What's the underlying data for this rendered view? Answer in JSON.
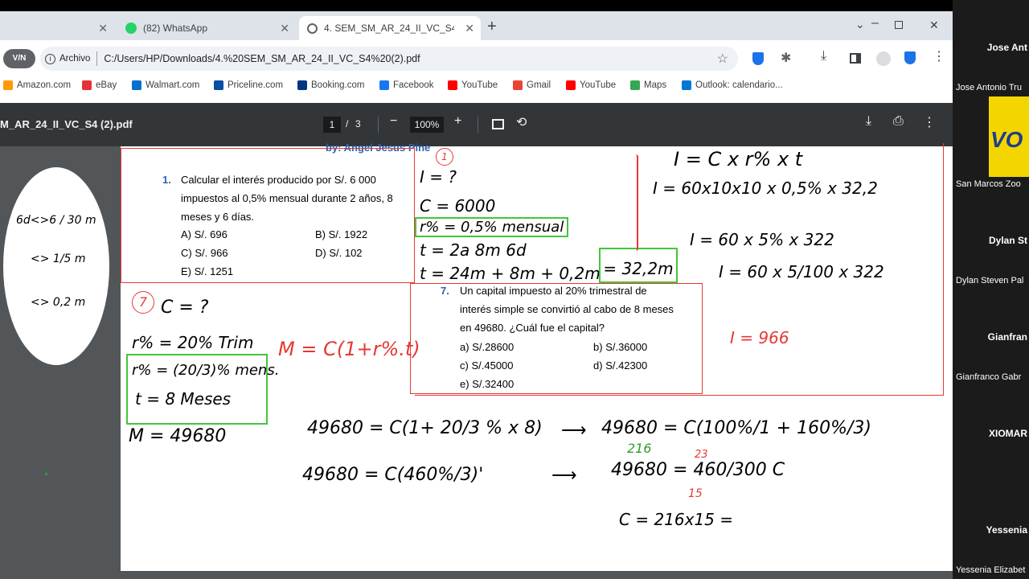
{
  "tabs": [
    {
      "label": ""
    },
    {
      "label": "(82) WhatsApp"
    },
    {
      "label": "4. SEM_SM_AR_24_II_VC_S4 (2).p"
    }
  ],
  "omnibox": {
    "chip": "Archivo",
    "url": "C:/Users/HP/Downloads/4.%20SEM_SM_AR_24_II_VC_S4%20(2).pdf"
  },
  "bookmarks": [
    {
      "label": "Amazon.com",
      "color": "#ff9900"
    },
    {
      "label": "eBay",
      "color": "#e53238"
    },
    {
      "label": "Walmart.com",
      "color": "#0071ce"
    },
    {
      "label": "Priceline.com",
      "color": "#0a4ea2"
    },
    {
      "label": "Booking.com",
      "color": "#003580"
    },
    {
      "label": "Facebook",
      "color": "#1877f2"
    },
    {
      "label": "YouTube",
      "color": "#ff0000"
    },
    {
      "label": "Gmail",
      "color": "#ea4335"
    },
    {
      "label": "YouTube",
      "color": "#ff0000"
    },
    {
      "label": "Maps",
      "color": "#34a853"
    },
    {
      "label": "Outlook: calendario...",
      "color": "#0078d4"
    }
  ],
  "pdf": {
    "title": "M_AR_24_II_VC_S4 (2).pdf",
    "page_current": "1",
    "page_sep": "/",
    "page_total": "3",
    "zoom": "100%"
  },
  "doc": {
    "header": "by: Angel Jesus Pine",
    "p1": {
      "num": "1.",
      "text": [
        "Calcular el interés producido por S/. 6 000",
        "impuestos al 0,5% mensual durante 2 años, 8",
        "meses y 6 días."
      ],
      "options": [
        [
          "A)",
          "S/. 696"
        ],
        [
          "B)",
          "S/. 1922"
        ],
        [
          "C)",
          "S/. 966"
        ],
        [
          "D)",
          "S/. 102"
        ],
        [
          "E)",
          "S/. 1251"
        ]
      ]
    },
    "p7": {
      "num": "7.",
      "text": [
        "Un capital impuesto al 20% trimestral de",
        "interés simple se convirtió al cabo de 8 meses",
        "en 49680. ¿Cuál fue el capital?"
      ],
      "options": [
        [
          "a)",
          "S/.28600"
        ],
        [
          "b)",
          "S/.36000"
        ],
        [
          "c)",
          "S/.45000"
        ],
        [
          "d)",
          "S/.42300"
        ],
        [
          "e)",
          "S/.32400"
        ]
      ]
    }
  },
  "notes": {
    "left": [
      "6d<>6 / 30 m",
      "<> 1/5 m",
      "<> 0,2 m"
    ],
    "sol1": [
      "I = ?",
      "C = 6000",
      "r% = 0,5% mensual",
      "t = 2a 8m 6d",
      "t = 24m + 8m + 0,2m",
      "= 32,2m"
    ],
    "right1": [
      "I = C x r% x t",
      "I = 60x10x10 x 0,5% x 32,2",
      "I = 60 x 5% x 322",
      "I = 60 x 5/100 x 322",
      "I = 966"
    ],
    "sol7": [
      "C = ?",
      "r% = 20% Trim",
      "r% = (20/3)% mens.",
      "t = 8 Meses",
      "M = 49680",
      "M = C(1+r%.t)"
    ],
    "work": [
      "49680 = C(1+ 20/3 % x 8)",
      "49680 = C(460%/3)'",
      "49680 = C(100%/1 + 160%/3)",
      "49680 = 460/300 C",
      "C = 216x15 ="
    ],
    "marks": [
      "1",
      "7",
      "216",
      "23",
      "15",
      "3",
      "2",
      "60",
      "8"
    ]
  },
  "participants": [
    {
      "name": "Jose Ant",
      "sub": "Jose Antonio Tru"
    },
    {
      "name": "",
      "sub": "San Marcos Zoo"
    },
    {
      "name": "Dylan St",
      "sub": "Dylan Steven Pal"
    },
    {
      "name": "Gianfran",
      "sub": "Gianfranco Gabr"
    },
    {
      "name": "XIOMAR",
      "sub": ""
    },
    {
      "name": "Yessenia",
      "sub": "Yessenia Elizabet"
    }
  ],
  "logo_text": "VO"
}
